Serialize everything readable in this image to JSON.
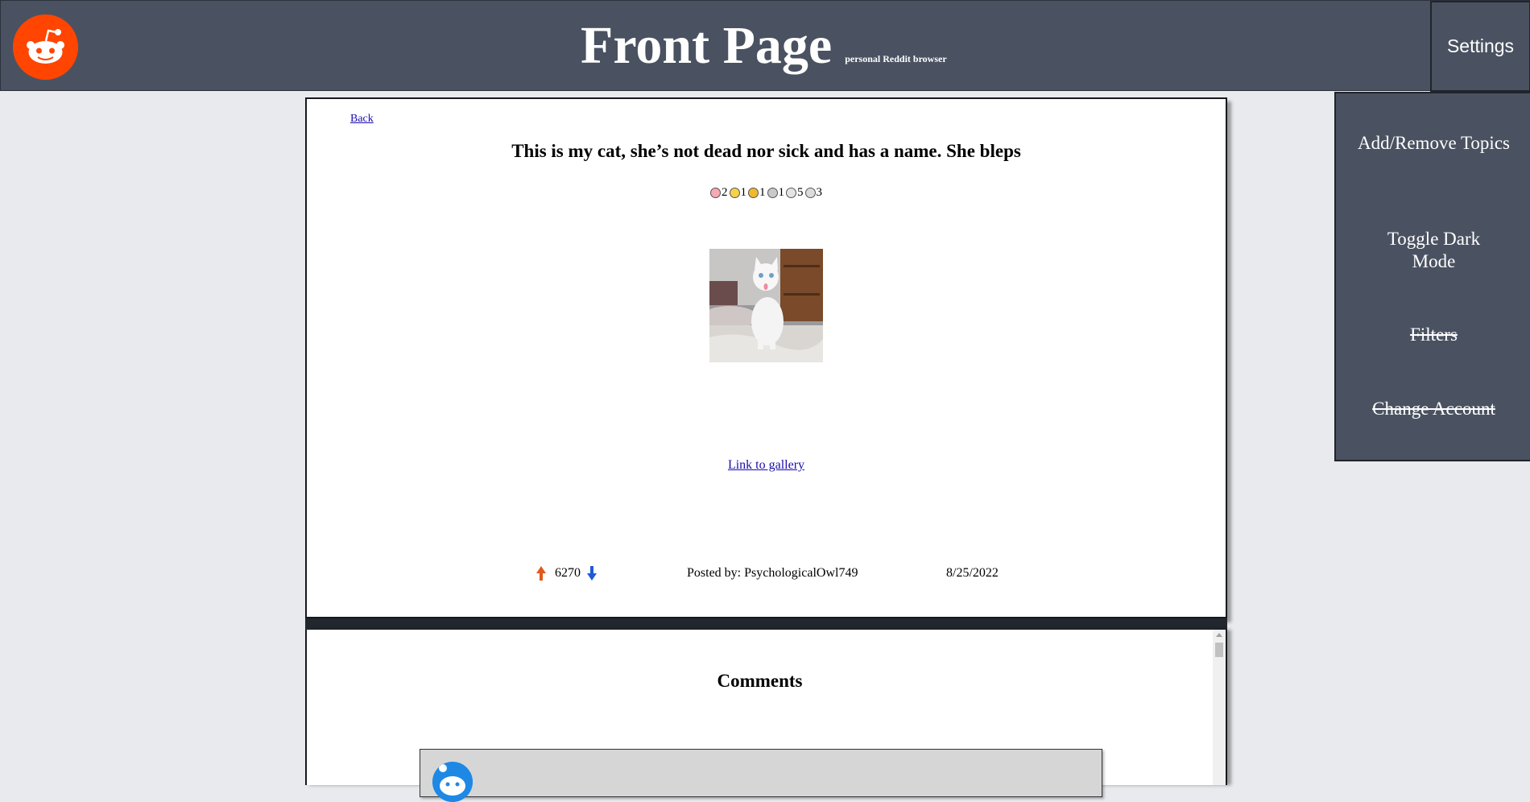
{
  "header": {
    "title": "Front Page",
    "subtitle": "personal Reddit browser",
    "settings_label": "Settings",
    "logo_icon": "reddit-alien-icon",
    "bg_color": "#4a5261",
    "logo_color": "#ff4500"
  },
  "settings_menu": {
    "items": [
      {
        "label": "Add/Remove Topics",
        "strikethrough": false
      },
      {
        "label": "Toggle Dark Mode",
        "strikethrough": false
      },
      {
        "label": "Filters",
        "strikethrough": true
      },
      {
        "label": "Change Account",
        "strikethrough": true
      }
    ]
  },
  "post": {
    "back_label": "Back",
    "title": "This is my cat, she’s not dead nor sick and has a name. She bleps",
    "awards": [
      {
        "icon": "heart-award-icon",
        "count": "2"
      },
      {
        "icon": "laughing-award-icon",
        "count": "1"
      },
      {
        "icon": "helpful-award-icon",
        "count": "1"
      },
      {
        "icon": "wholesome-award-icon",
        "count": "1"
      },
      {
        "icon": "silver-award-icon",
        "count": "5"
      },
      {
        "icon": "coin-award-icon",
        "count": "3"
      }
    ],
    "image_alt": "white cat blepping",
    "gallery_link": "Link to gallery",
    "score": "6270",
    "author": "Posted by: PsychologicalOwl749",
    "date": "8/25/2022",
    "upvote_color": "#e05a1b",
    "downvote_color": "#1f5ad6"
  },
  "comments": {
    "heading": "Comments"
  }
}
